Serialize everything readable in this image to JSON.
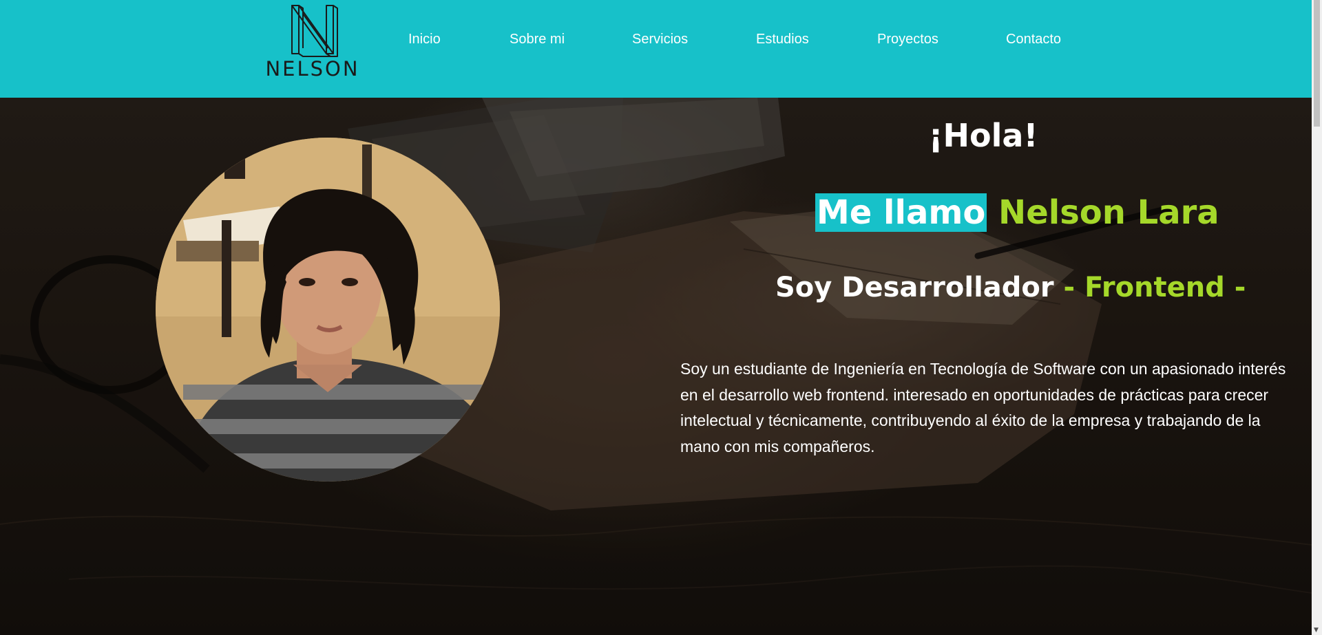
{
  "brand": {
    "name": "NELSON",
    "logo_icon": "n-monogram-icon"
  },
  "nav": {
    "items": [
      {
        "label": "Inicio"
      },
      {
        "label": "Sobre mi"
      },
      {
        "label": "Servicios"
      },
      {
        "label": "Estudios"
      },
      {
        "label": "Proyectos"
      },
      {
        "label": "Contacto"
      }
    ]
  },
  "hero": {
    "greeting": "¡Hola!",
    "name_prefix": "Me llamo",
    "name": "Nelson Lara",
    "role_prefix": "Soy Desarrollador",
    "role": "- Frontend -",
    "bio": "Soy un estudiante de Ingeniería en Tecnología de Software con un apasionado interés en el desarrollo web frontend. interesado en oportunidades de prácticas para crecer intelectual y técnicamente, contribuyendo al éxito de la empresa y trabajando de la mano con mis compañeros."
  },
  "colors": {
    "navbar": "#17c1c9",
    "accent_green": "#a5d82a",
    "highlight": "#17c1c9",
    "text": "#ffffff"
  }
}
